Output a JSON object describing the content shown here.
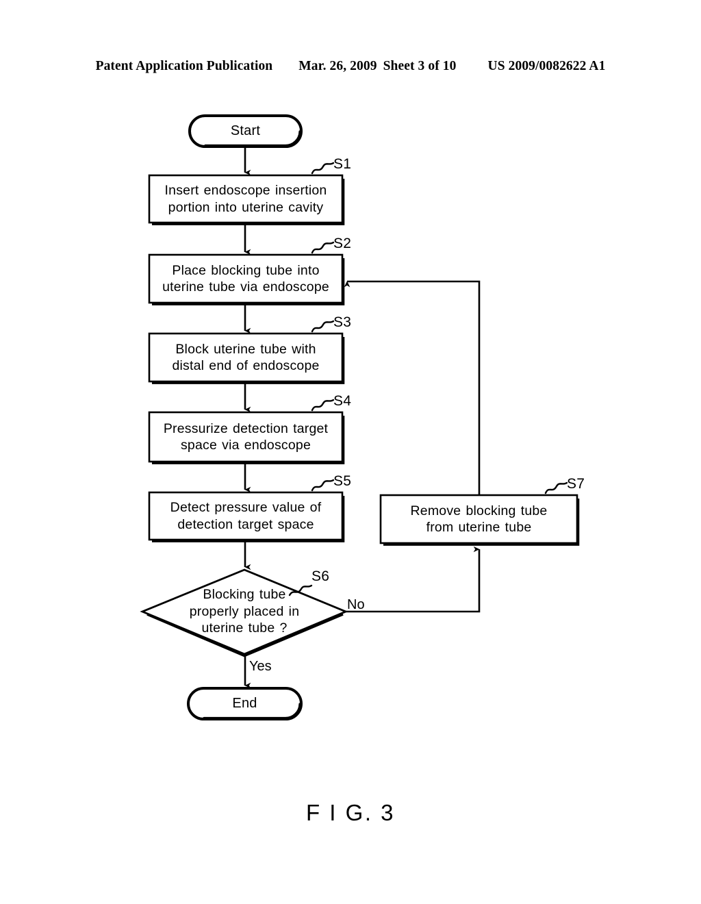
{
  "header": {
    "publication": "Patent Application Publication",
    "date": "Mar. 26, 2009",
    "sheet": "Sheet 3 of 10",
    "number": "US 2009/0082622 A1"
  },
  "figure": {
    "caption": "F I G. 3",
    "ink_color": "#000000",
    "background_color": "#ffffff"
  },
  "flowchart": {
    "start": {
      "label": "Start"
    },
    "end": {
      "label": "End"
    },
    "steps": [
      {
        "ref": "S1",
        "line1": "Insert endoscope insertion",
        "line2": "portion into uterine cavity"
      },
      {
        "ref": "S2",
        "line1": "Place blocking tube into",
        "line2": "uterine tube via endoscope"
      },
      {
        "ref": "S3",
        "line1": "Block uterine tube with",
        "line2": "distal end of endoscope"
      },
      {
        "ref": "S4",
        "line1": "Pressurize detection target",
        "line2": "space via endoscope"
      },
      {
        "ref": "S5",
        "line1": "Detect pressure value of",
        "line2": "detection target space"
      },
      {
        "ref": "S7",
        "line1": "Remove blocking tube",
        "line2": "from uterine tube"
      }
    ],
    "decision": {
      "ref": "S6",
      "line1": "Blocking tube",
      "line2": "properly placed in",
      "line3": "uterine tube ?",
      "branch_no": "No",
      "branch_yes": "Yes"
    }
  }
}
